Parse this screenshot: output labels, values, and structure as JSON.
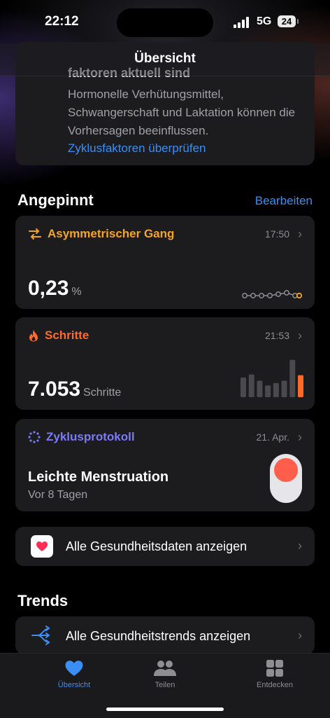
{
  "status": {
    "time": "22:12",
    "network": "5G",
    "battery": "24"
  },
  "nav": {
    "title": "Übersicht"
  },
  "factors": {
    "partial_heading": "faktoren aktuell sind",
    "description": "Hormonelle Verhütungsmittel, Schwangerschaft und Laktation können die Vorhersagen beeinflussen.",
    "link": "Zyklusfaktoren überprüfen"
  },
  "pinned": {
    "title": "Angepinnt",
    "edit": "Bearbeiten",
    "gait": {
      "title": "Asymmetrischer Gang",
      "time": "17:50",
      "value": "0,23",
      "unit": "%",
      "icon": "arrows-icon",
      "color": "#f5a524"
    },
    "steps": {
      "title": "Schritte",
      "time": "21:53",
      "value": "7.053",
      "unit": "Schritte",
      "icon": "flame-icon",
      "color": "#ff6a2b"
    },
    "cycle": {
      "title": "Zyklusprotokoll",
      "date": "21. Apr.",
      "entry": "Leichte Menstruation",
      "ago": "Vor 8 Tagen",
      "icon": "cycle-icon",
      "color": "#6e6ef0"
    }
  },
  "all_health": "Alle Gesundheitsdaten anzeigen",
  "trends": {
    "title": "Trends",
    "all_trends": "Alle Gesundheitstrends anzeigen"
  },
  "tabs": [
    {
      "label": "Übersicht",
      "icon": "heart-icon",
      "active": true
    },
    {
      "label": "Teilen",
      "icon": "people-icon",
      "active": false
    },
    {
      "label": "Entdecken",
      "icon": "grid-icon",
      "active": false
    }
  ],
  "chart_data": {
    "type": "bar",
    "title": "",
    "values": [
      0.5,
      0.58,
      0.42,
      0.3,
      0.36,
      0.42,
      0.95,
      0.56
    ],
    "highlight_last": true
  }
}
